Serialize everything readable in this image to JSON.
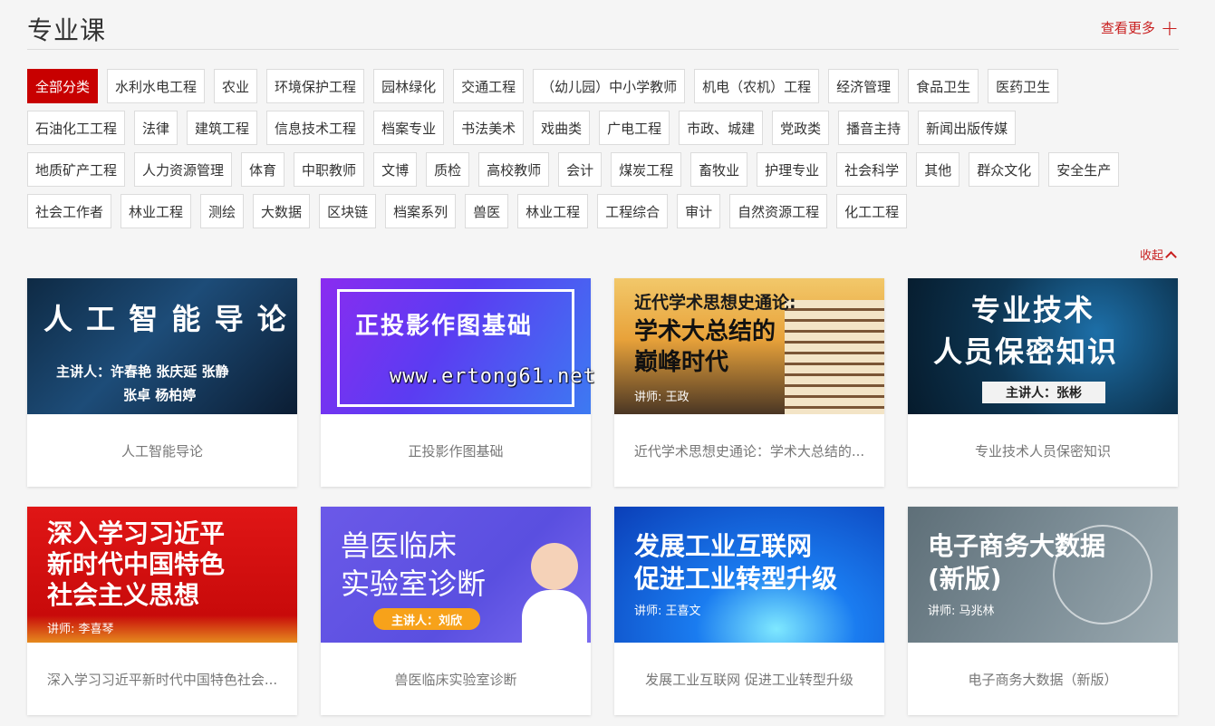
{
  "header": {
    "title": "专业课",
    "more_label": "查看更多",
    "plus": "+"
  },
  "tags": [
    [
      "全部分类",
      "水利水电工程",
      "农业",
      "环境保护工程",
      "园林绿化",
      "交通工程",
      "（幼儿园）中小学教师",
      "机电（农机）工程",
      "经济管理",
      "食品卫生",
      "医药卫生"
    ],
    [
      "石油化工工程",
      "法律",
      "建筑工程",
      "信息技术工程",
      "档案专业",
      "书法美术",
      "戏曲类",
      "广电工程",
      "市政、城建",
      "党政类",
      "播音主持",
      "新闻出版传媒"
    ],
    [
      "地质矿产工程",
      "人力资源管理",
      "体育",
      "中职教师",
      "文博",
      "质检",
      "高校教师",
      "会计",
      "煤炭工程",
      "畜牧业",
      "护理专业",
      "社会科学",
      "其他",
      "群众文化",
      "安全生产"
    ],
    [
      "社会工作者",
      "林业工程",
      "测绘",
      "大数据",
      "区块链",
      "档案系列",
      "兽医",
      "林业工程",
      "工程综合",
      "审计",
      "自然资源工程",
      "化工工程"
    ]
  ],
  "collapse_label": "收起",
  "watermark": "www.ertong61.net",
  "courses": [
    {
      "caption": "人工智能导论",
      "thumb": [
        "人 工 智 能 导 论",
        "主讲人：许春艳  张庆延  张静",
        "张卓  杨柏婷"
      ]
    },
    {
      "caption": "正投影作图基础",
      "thumb": [
        "正投影作图基础"
      ]
    },
    {
      "caption": "近代学术思想史通论：学术大总结的...",
      "thumb": [
        "近代学术思想史通论:",
        "学术大总结的",
        "巅峰时代",
        "讲师: 王政"
      ]
    },
    {
      "caption": "专业技术人员保密知识",
      "thumb": [
        "专业技术",
        "人员保密知识",
        "主讲人：张彬"
      ]
    },
    {
      "caption": "深入学习习近平新时代中国特色社会...",
      "thumb": [
        "深入学习习近平",
        "新时代中国特色",
        "社会主义思想",
        "讲师: 李喜琴"
      ]
    },
    {
      "caption": "兽医临床实验室诊断",
      "thumb": [
        "兽医临床",
        "实验室诊断",
        "主讲人：刘欣"
      ]
    },
    {
      "caption": "发展工业互联网 促进工业转型升级",
      "thumb": [
        "发展工业互联网",
        "促进工业转型升级",
        "讲师: 王喜文"
      ]
    },
    {
      "caption": "电子商务大数据（新版）",
      "thumb": [
        "电子商务大数据",
        "(新版)",
        "讲师: 马兆林"
      ]
    }
  ]
}
